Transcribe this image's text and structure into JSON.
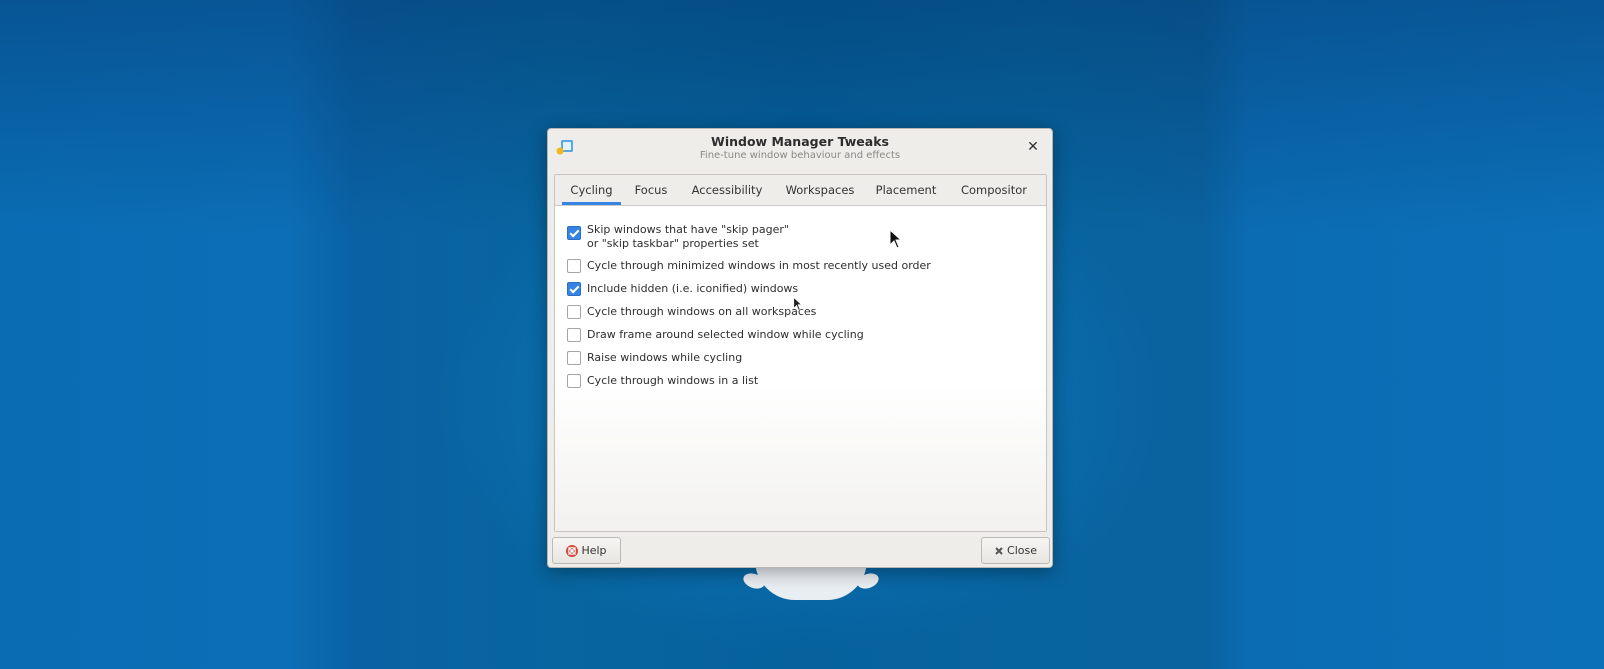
{
  "window": {
    "title": "Window Manager Tweaks",
    "subtitle": "Fine-tune window behaviour and effects",
    "close_glyph": "✕"
  },
  "tabs": [
    {
      "label": "Cycling",
      "active": true
    },
    {
      "label": "Focus",
      "active": false
    },
    {
      "label": "Accessibility",
      "active": false
    },
    {
      "label": "Workspaces",
      "active": false
    },
    {
      "label": "Placement",
      "active": false
    },
    {
      "label": "Compositor",
      "active": false
    }
  ],
  "options": [
    {
      "line1": "Skip windows that have \"skip pager\"",
      "line2": "or \"skip taskbar\" properties set",
      "checked": true
    },
    {
      "line1": "Cycle through minimized windows in most recently used order",
      "checked": false
    },
    {
      "line1": "Include hidden (i.e. iconified) windows",
      "checked": true
    },
    {
      "line1": "Cycle through windows on all workspaces",
      "checked": false
    },
    {
      "line1": "Draw frame around selected window while cycling",
      "checked": false
    },
    {
      "line1": "Raise windows while cycling",
      "checked": false
    },
    {
      "line1": "Cycle through windows in a list",
      "checked": false
    }
  ],
  "buttons": {
    "help_label": "Help",
    "help_icon": "help-lifebuoy-icon",
    "close_label": "Close",
    "close_icon": "close-x-icon"
  },
  "colors": {
    "accent": "#3584e4",
    "desktop": "#0a6db4"
  }
}
